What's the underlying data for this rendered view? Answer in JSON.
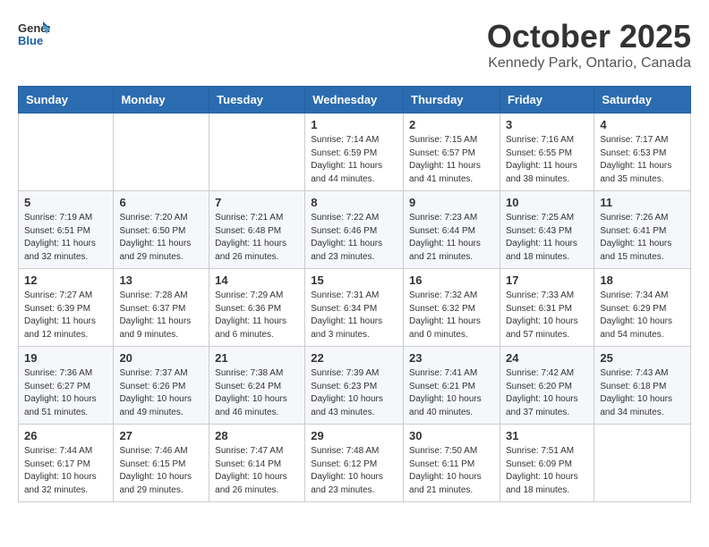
{
  "header": {
    "logo_general": "General",
    "logo_blue": "Blue",
    "month_title": "October 2025",
    "location": "Kennedy Park, Ontario, Canada"
  },
  "days_of_week": [
    "Sunday",
    "Monday",
    "Tuesday",
    "Wednesday",
    "Thursday",
    "Friday",
    "Saturday"
  ],
  "weeks": [
    [
      {
        "day": "",
        "info": ""
      },
      {
        "day": "",
        "info": ""
      },
      {
        "day": "",
        "info": ""
      },
      {
        "day": "1",
        "info": "Sunrise: 7:14 AM\nSunset: 6:59 PM\nDaylight: 11 hours and 44 minutes."
      },
      {
        "day": "2",
        "info": "Sunrise: 7:15 AM\nSunset: 6:57 PM\nDaylight: 11 hours and 41 minutes."
      },
      {
        "day": "3",
        "info": "Sunrise: 7:16 AM\nSunset: 6:55 PM\nDaylight: 11 hours and 38 minutes."
      },
      {
        "day": "4",
        "info": "Sunrise: 7:17 AM\nSunset: 6:53 PM\nDaylight: 11 hours and 35 minutes."
      }
    ],
    [
      {
        "day": "5",
        "info": "Sunrise: 7:19 AM\nSunset: 6:51 PM\nDaylight: 11 hours and 32 minutes."
      },
      {
        "day": "6",
        "info": "Sunrise: 7:20 AM\nSunset: 6:50 PM\nDaylight: 11 hours and 29 minutes."
      },
      {
        "day": "7",
        "info": "Sunrise: 7:21 AM\nSunset: 6:48 PM\nDaylight: 11 hours and 26 minutes."
      },
      {
        "day": "8",
        "info": "Sunrise: 7:22 AM\nSunset: 6:46 PM\nDaylight: 11 hours and 23 minutes."
      },
      {
        "day": "9",
        "info": "Sunrise: 7:23 AM\nSunset: 6:44 PM\nDaylight: 11 hours and 21 minutes."
      },
      {
        "day": "10",
        "info": "Sunrise: 7:25 AM\nSunset: 6:43 PM\nDaylight: 11 hours and 18 minutes."
      },
      {
        "day": "11",
        "info": "Sunrise: 7:26 AM\nSunset: 6:41 PM\nDaylight: 11 hours and 15 minutes."
      }
    ],
    [
      {
        "day": "12",
        "info": "Sunrise: 7:27 AM\nSunset: 6:39 PM\nDaylight: 11 hours and 12 minutes."
      },
      {
        "day": "13",
        "info": "Sunrise: 7:28 AM\nSunset: 6:37 PM\nDaylight: 11 hours and 9 minutes."
      },
      {
        "day": "14",
        "info": "Sunrise: 7:29 AM\nSunset: 6:36 PM\nDaylight: 11 hours and 6 minutes."
      },
      {
        "day": "15",
        "info": "Sunrise: 7:31 AM\nSunset: 6:34 PM\nDaylight: 11 hours and 3 minutes."
      },
      {
        "day": "16",
        "info": "Sunrise: 7:32 AM\nSunset: 6:32 PM\nDaylight: 11 hours and 0 minutes."
      },
      {
        "day": "17",
        "info": "Sunrise: 7:33 AM\nSunset: 6:31 PM\nDaylight: 10 hours and 57 minutes."
      },
      {
        "day": "18",
        "info": "Sunrise: 7:34 AM\nSunset: 6:29 PM\nDaylight: 10 hours and 54 minutes."
      }
    ],
    [
      {
        "day": "19",
        "info": "Sunrise: 7:36 AM\nSunset: 6:27 PM\nDaylight: 10 hours and 51 minutes."
      },
      {
        "day": "20",
        "info": "Sunrise: 7:37 AM\nSunset: 6:26 PM\nDaylight: 10 hours and 49 minutes."
      },
      {
        "day": "21",
        "info": "Sunrise: 7:38 AM\nSunset: 6:24 PM\nDaylight: 10 hours and 46 minutes."
      },
      {
        "day": "22",
        "info": "Sunrise: 7:39 AM\nSunset: 6:23 PM\nDaylight: 10 hours and 43 minutes."
      },
      {
        "day": "23",
        "info": "Sunrise: 7:41 AM\nSunset: 6:21 PM\nDaylight: 10 hours and 40 minutes."
      },
      {
        "day": "24",
        "info": "Sunrise: 7:42 AM\nSunset: 6:20 PM\nDaylight: 10 hours and 37 minutes."
      },
      {
        "day": "25",
        "info": "Sunrise: 7:43 AM\nSunset: 6:18 PM\nDaylight: 10 hours and 34 minutes."
      }
    ],
    [
      {
        "day": "26",
        "info": "Sunrise: 7:44 AM\nSunset: 6:17 PM\nDaylight: 10 hours and 32 minutes."
      },
      {
        "day": "27",
        "info": "Sunrise: 7:46 AM\nSunset: 6:15 PM\nDaylight: 10 hours and 29 minutes."
      },
      {
        "day": "28",
        "info": "Sunrise: 7:47 AM\nSunset: 6:14 PM\nDaylight: 10 hours and 26 minutes."
      },
      {
        "day": "29",
        "info": "Sunrise: 7:48 AM\nSunset: 6:12 PM\nDaylight: 10 hours and 23 minutes."
      },
      {
        "day": "30",
        "info": "Sunrise: 7:50 AM\nSunset: 6:11 PM\nDaylight: 10 hours and 21 minutes."
      },
      {
        "day": "31",
        "info": "Sunrise: 7:51 AM\nSunset: 6:09 PM\nDaylight: 10 hours and 18 minutes."
      },
      {
        "day": "",
        "info": ""
      }
    ]
  ]
}
